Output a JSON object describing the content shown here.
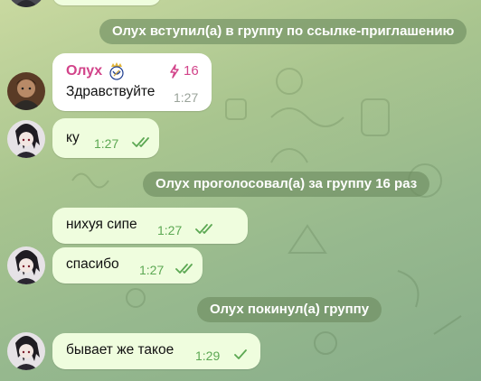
{
  "colors": {
    "sender_name": "#d2448a",
    "boost": "#d2448a",
    "checks": "#5ca853",
    "service_bg": "#6c8a60",
    "outgoing_bg": "#effdde"
  },
  "service_messages": {
    "joined": "Олух вступил(а) в группу по ссылке-приглашению",
    "boosted": "Олух проголосовал(а) за группу 16 раз",
    "left": "Олух покинул(а) группу"
  },
  "incoming_message": {
    "sender": "Олух",
    "sender_badge_icon": "real-madrid-emoji",
    "boost_icon": "lightning-icon",
    "boost_count": "16",
    "text": "Здравствуйте",
    "time": "1:27"
  },
  "outgoing_messages": [
    {
      "text": "ку",
      "time": "1:27",
      "status": "read"
    },
    {
      "text": "нихуя сипе",
      "time": "1:27",
      "status": "read"
    },
    {
      "text": "спасибо",
      "time": "1:27",
      "status": "read"
    },
    {
      "text": "бывает же такое",
      "time": "1:29",
      "status": "sent"
    }
  ]
}
